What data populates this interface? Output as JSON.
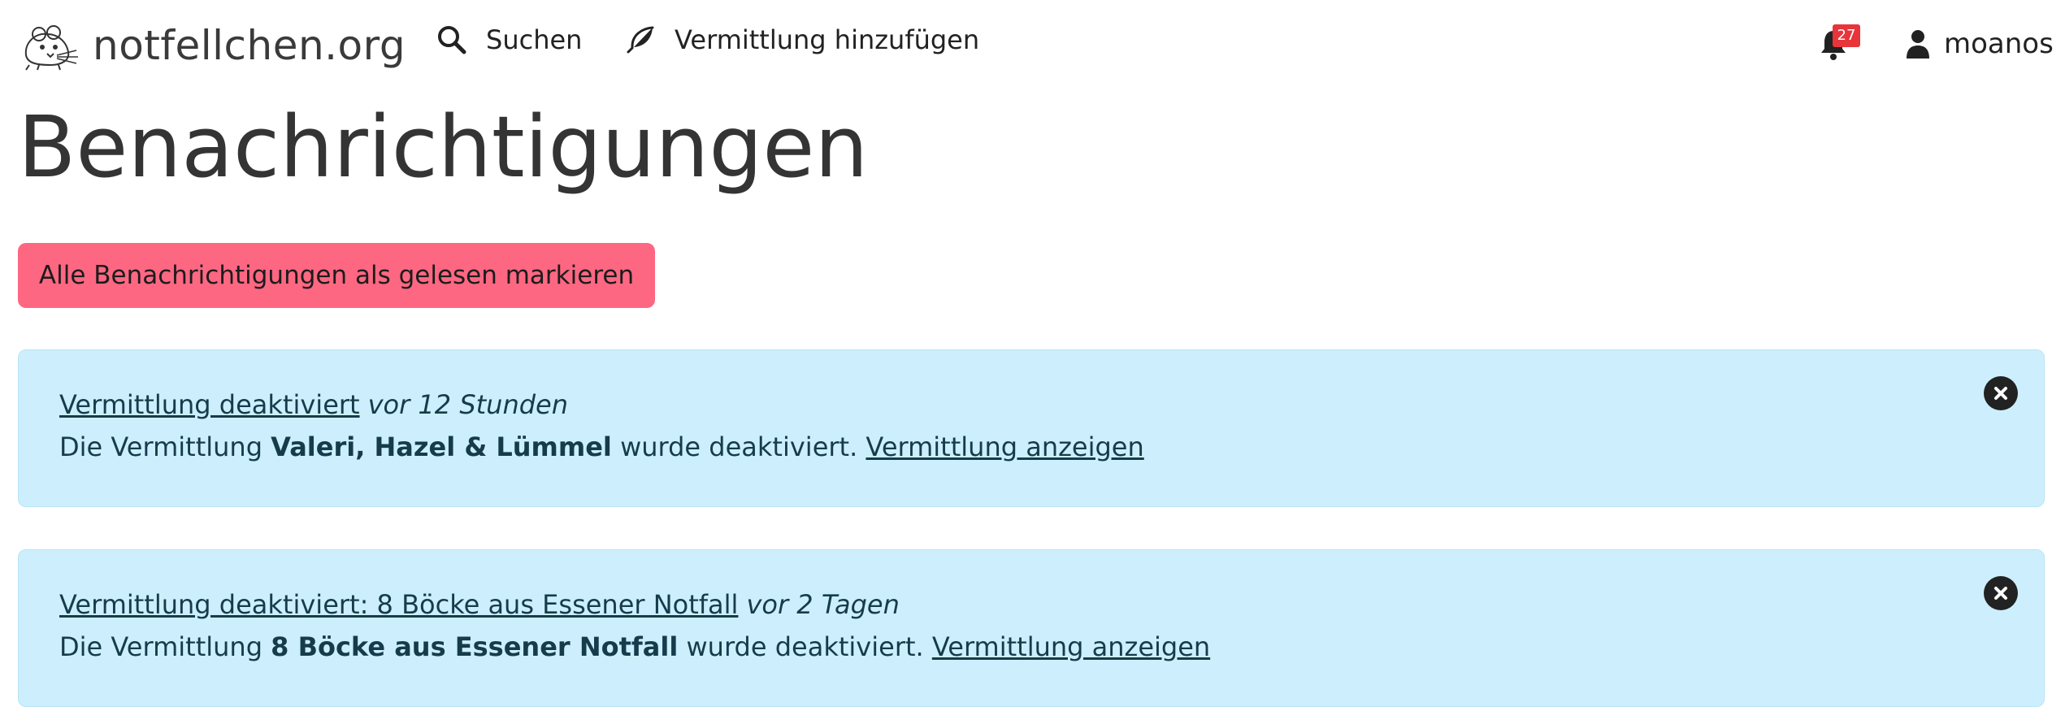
{
  "navbar": {
    "brand": "notfellchen.org",
    "search_label": "Suchen",
    "add_label": "Vermittlung hinzufügen",
    "notification_count": "27",
    "username": "moanos",
    "icons": [
      "rat-logo",
      "search-icon",
      "feather-icon",
      "bell-icon",
      "user-icon"
    ]
  },
  "page": {
    "title": "Benachrichtigungen",
    "mark_all_label": "Alle Benachrichtigungen als gelesen markieren"
  },
  "notifications": [
    {
      "title": "Vermittlung deaktiviert",
      "time": "vor 12 Stunden",
      "text_before": "Die Vermittlung ",
      "name": "Valeri, Hazel & Lümmel",
      "text_after": " wurde deaktiviert. ",
      "link": "Vermittlung anzeigen"
    },
    {
      "title": "Vermittlung deaktiviert: 8 Böcke aus Essener Notfall",
      "time": "vor 2 Tagen",
      "text_before": "Die Vermittlung ",
      "name": "8 Böcke aus Essener Notfall",
      "text_after": " wurde deaktiviert. ",
      "link": "Vermittlung anzeigen"
    }
  ],
  "colors": {
    "button_bg": "#fe6782",
    "alert_bg": "#cdeffd",
    "badge_bg": "#e8343b"
  }
}
